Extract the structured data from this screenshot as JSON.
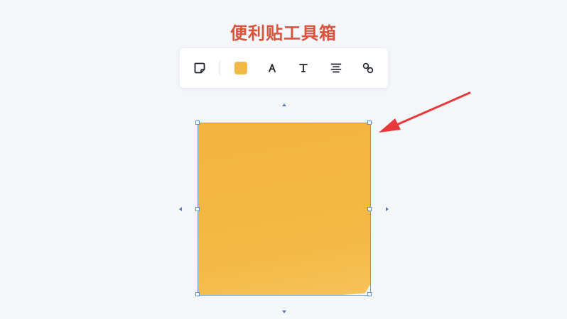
{
  "page": {
    "title": "便利贴工具箱"
  },
  "toolbar": {
    "tools": [
      {
        "name": "sticky-shape",
        "icon": "sticky-note-icon"
      },
      {
        "name": "fill-color",
        "icon": "color-swatch-icon",
        "color": "#f3b947"
      },
      {
        "name": "font-color",
        "icon": "font-a-icon"
      },
      {
        "name": "text-style",
        "icon": "text-t-icon"
      },
      {
        "name": "align",
        "icon": "align-center-icon"
      },
      {
        "name": "link",
        "icon": "link-icon"
      }
    ]
  },
  "sticky_note": {
    "fill_color": "#f4b942",
    "selected": true
  },
  "annotation": {
    "color": "#e8393a",
    "icon": "red-arrow-icon"
  }
}
